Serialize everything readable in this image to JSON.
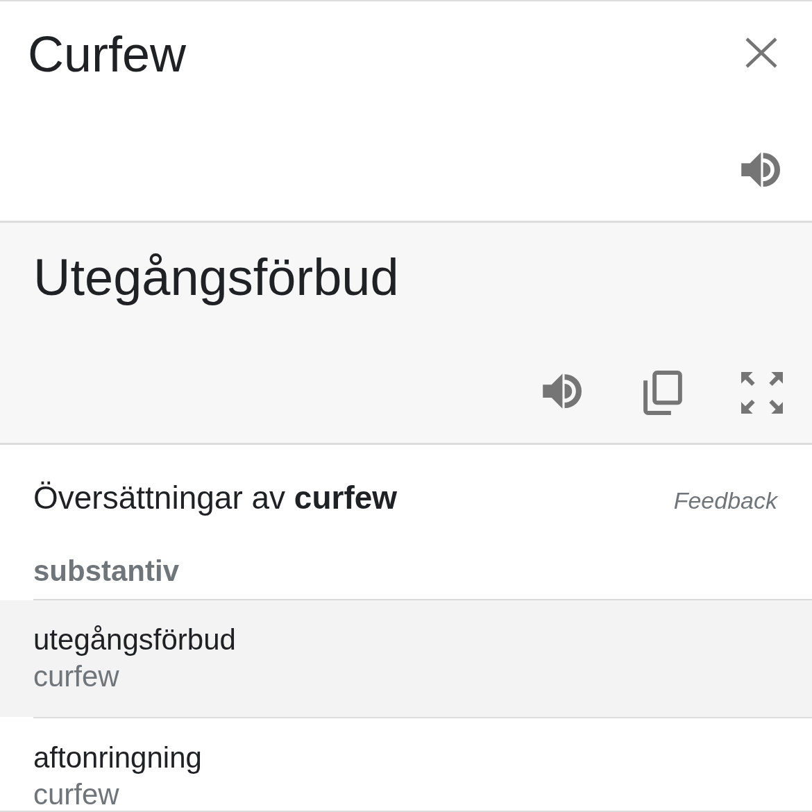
{
  "source": {
    "text": "Curfew"
  },
  "translation": {
    "text": "Utegångsförbud"
  },
  "dictionary": {
    "heading": "Översättningar av **curfew**",
    "feedback": "Feedback",
    "groups": [
      {
        "part_of_speech": "substantiv",
        "entries": [
          {
            "word": "utegångsförbud",
            "back_translation": "curfew",
            "selected": true
          },
          {
            "word": "aftonringning",
            "back_translation": "curfew",
            "selected": false
          }
        ]
      }
    ]
  }
}
